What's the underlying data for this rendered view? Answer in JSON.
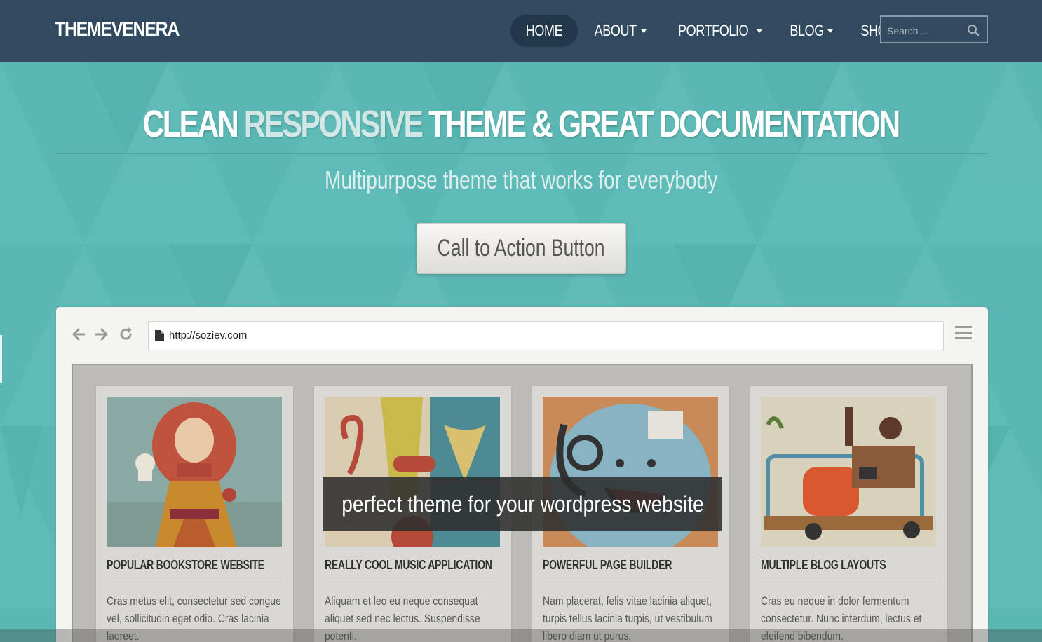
{
  "header": {
    "logo": "THEMEVENERA",
    "nav": [
      {
        "label": "HOME",
        "active": true,
        "dropdown": false
      },
      {
        "label": "ABOUT",
        "active": false,
        "dropdown": true
      },
      {
        "label": "PORTFOLIO",
        "active": false,
        "dropdown": true
      },
      {
        "label": "BLOG",
        "active": false,
        "dropdown": true
      },
      {
        "label": "SHOP",
        "active": false,
        "dropdown": true
      }
    ],
    "search": {
      "placeholder": "Search ...",
      "icon": "search-icon"
    }
  },
  "hero": {
    "title_part1": "CLEAN",
    "title_highlight": "RESPONSIVE",
    "title_part2": "THEME & GREAT DOCUMENTATION",
    "subtitle": "Multipurpose theme that works for everybody",
    "cta_label": "Call to Action Button"
  },
  "browser": {
    "url": "http://soziev.com",
    "icons": [
      "back-arrow-icon",
      "forward-arrow-icon",
      "reload-icon",
      "document-icon",
      "hamburger-menu-icon"
    ]
  },
  "cards": [
    {
      "title": "POPULAR BOOKSTORE WEBSITE",
      "text": "Cras metus elit, consectetur sed congue vel, sollicitudin eget odio. Cras lacinia laoreet."
    },
    {
      "title": "REALLY COOL MUSIC APPLICATION",
      "text": "Aliquam et leo eu neque consequat aliquet sed nec lectus. Suspendisse potenti."
    },
    {
      "title": "POWERFUL PAGE BUILDER",
      "text": "Nam placerat, felis vitae lacinia aliquet, turpis tellus lacinia turpis, ut vestibulum libero diam ut purus."
    },
    {
      "title": "MULTIPLE BLOG LAYOUTS",
      "text": "Cras eu neque in dolor fermentum consectetur. Nunc interdum, lectus et eleifend bibendum."
    }
  ],
  "overlay_text": "perfect theme for your wordpress website",
  "colors": {
    "header_bg": "#324a5f",
    "hero_bg": "#5bb7b3",
    "active_nav": "#22384a"
  }
}
